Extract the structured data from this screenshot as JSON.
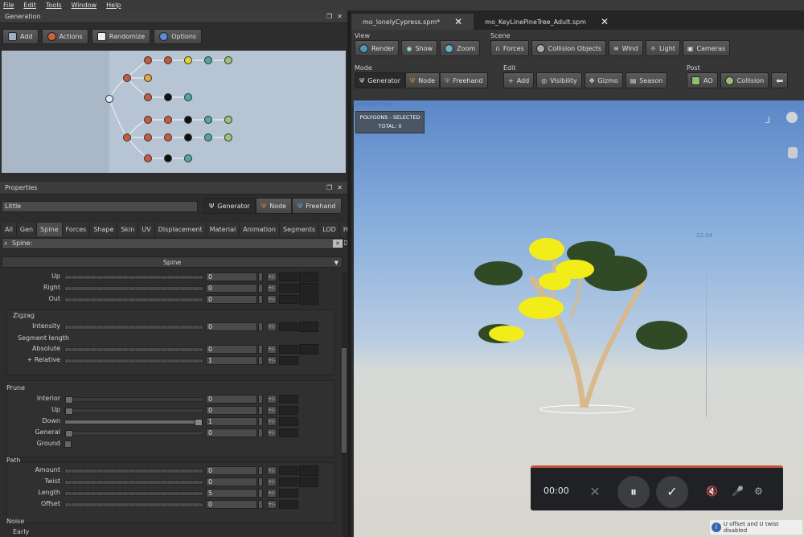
{
  "menu": [
    "File",
    "Edit",
    "Tools",
    "Window",
    "Help"
  ],
  "generation": {
    "title": "Generation",
    "toolbar": [
      "Add",
      "Actions",
      "Randomize",
      "Options"
    ]
  },
  "properties": {
    "title": "Properties",
    "name_value": "Little",
    "modes": [
      "Generator",
      "Node",
      "Freehand"
    ],
    "tabs": [
      "All",
      "Gen",
      "Spine",
      "Forces",
      "Shape",
      "Skin",
      "UV",
      "Displacement",
      "Material",
      "Animation",
      "Segments",
      "LOD",
      "Hand Drawn"
    ],
    "search_value": "Spine:",
    "section": "Spine",
    "rows_top": [
      {
        "label": "Up",
        "value": "0"
      },
      {
        "label": "Right",
        "value": "0"
      },
      {
        "label": "Out",
        "value": "0"
      }
    ],
    "zigzag": {
      "label": "Zigzag",
      "intensity": {
        "label": "Intensity",
        "value": "0"
      },
      "segment_length": "Segment length",
      "absolute": {
        "label": "Absolute",
        "value": "0"
      },
      "relative": {
        "label": "+ Relative",
        "value": "1"
      }
    },
    "prune": {
      "label": "Prune",
      "interior": {
        "label": "Interior",
        "value": "0"
      },
      "up": {
        "label": "Up",
        "value": "0"
      },
      "down": {
        "label": "Down",
        "value": "1"
      },
      "general": {
        "label": "General",
        "value": "0"
      },
      "ground": "Ground"
    },
    "path": {
      "label": "Path",
      "amount": {
        "label": "Amount",
        "value": "0"
      },
      "twist": {
        "label": "Twist",
        "value": "0"
      },
      "length": {
        "label": "Length",
        "value": "5"
      },
      "offset": {
        "label": "Offset",
        "value": "0"
      }
    },
    "noise": {
      "label": "Noise",
      "early": "Early"
    }
  },
  "doc_tabs": [
    "mo_lonelyCypress.spm*",
    "mo_KeyLinePineTree_Adult.spm"
  ],
  "toolbar": {
    "view": {
      "label": "View",
      "buttons": [
        "Render",
        "Show",
        "Zoom"
      ]
    },
    "scene": {
      "label": "Scene",
      "buttons": [
        "Forces",
        "Collision Objects",
        "Wind",
        "Light",
        "Cameras"
      ]
    },
    "mode": {
      "label": "Mode",
      "buttons": [
        "Generator",
        "Node",
        "Freehand"
      ]
    },
    "edit": {
      "label": "Edit",
      "buttons": [
        "Add",
        "Visibility",
        "Gizmo",
        "Season"
      ]
    },
    "post": {
      "label": "Post",
      "buttons": [
        "AO",
        "Collision"
      ]
    }
  },
  "viewport": {
    "camera": "perspective",
    "polygons_label": "POLYGONS - SELECTED",
    "total_label": "TOTAL:  0",
    "height_readout": "22.94"
  },
  "recorder": {
    "time": "00:00"
  },
  "status_text": "U offset and U twist disabled"
}
